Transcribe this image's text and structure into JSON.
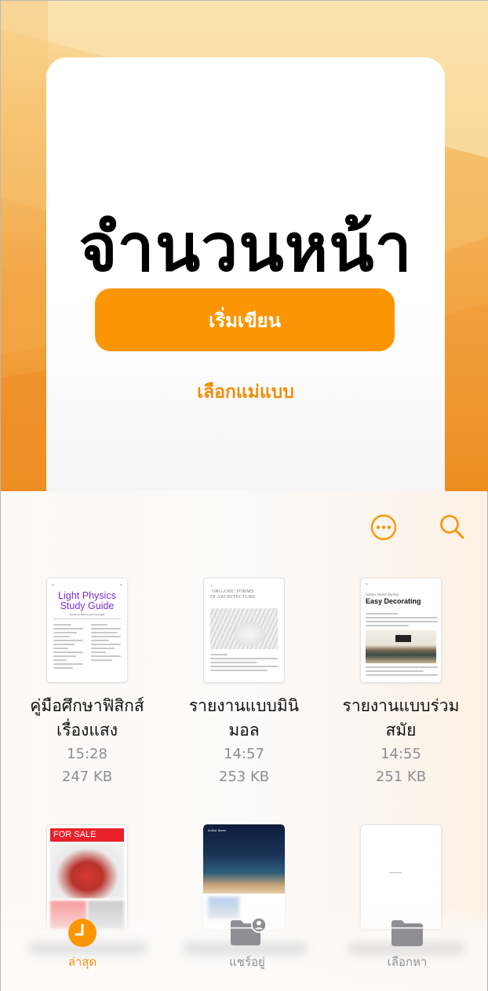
{
  "welcome": {
    "title": "จำนวนหน้า",
    "start_button": "เริ่มเขียน",
    "choose_template_link": "เลือกแม่แบบ"
  },
  "toolbar": {
    "more_icon": "ellipsis-circle-icon",
    "search_icon": "magnifying-glass-icon"
  },
  "documents": [
    {
      "name_line1": "คู่มือศึกษาฟิสิกส์",
      "name_line2": "เรื่องแสง",
      "time": "15:28",
      "size": "247 KB",
      "thumb": {
        "title_line1": "Light Physics",
        "title_line2": "Study Guide",
        "subtitle": "Common Terms and Concepts"
      }
    },
    {
      "name_line1": "รายงานแบบมินิ",
      "name_line2": "มอล",
      "time": "14:57",
      "size": "253 KB",
      "thumb": {
        "title_line1": "ORGANIC FORMS",
        "title_line2": "IN ARCHITECTURE"
      }
    },
    {
      "name_line1": "รายงานแบบร่วม",
      "name_line2": "สมัย",
      "time": "14:55",
      "size": "251 KB",
      "thumb": {
        "subtitle": "Simple Home Styling",
        "title": "Easy Decorating"
      }
    },
    {
      "thumb": {
        "title": "FOR SALE"
      }
    },
    {
      "thumb": {
        "author": "Author Name"
      }
    },
    {
      "thumb": {}
    }
  ],
  "tabbar": {
    "tabs": [
      {
        "label": "ล่าสุด",
        "icon": "clock-icon",
        "active": true
      },
      {
        "label": "แชร์อยู่",
        "icon": "shared-folder-icon",
        "active": false
      },
      {
        "label": "เลือกหา",
        "icon": "folder-icon",
        "active": false
      }
    ]
  },
  "colors": {
    "accent": "#fb9503",
    "accent_text": "#f08d0a",
    "secondary_text": "#8e8e93",
    "icon_gray": "#8e8e93"
  }
}
